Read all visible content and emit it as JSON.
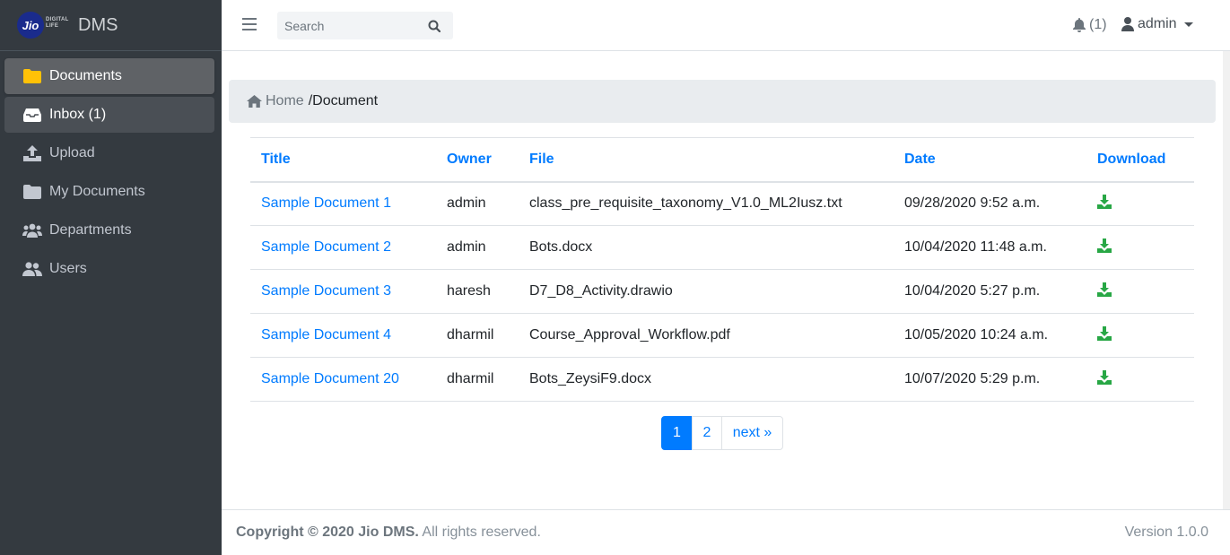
{
  "brand": {
    "logo_text": "Jio",
    "logo_tag_1": "DIGITAL",
    "logo_tag_2": "LIFE",
    "name": "DMS"
  },
  "sidebar": {
    "items": [
      {
        "label": "Documents",
        "icon": "folder-icon",
        "state": "active"
      },
      {
        "label": "Inbox (1)",
        "icon": "inbox-icon",
        "state": "open"
      },
      {
        "label": "Upload",
        "icon": "upload-icon",
        "state": ""
      },
      {
        "label": "My Documents",
        "icon": "folder-icon",
        "state": ""
      },
      {
        "label": "Departments",
        "icon": "users-group-icon",
        "state": ""
      },
      {
        "label": "Users",
        "icon": "users-icon",
        "state": ""
      }
    ]
  },
  "header": {
    "search_placeholder": "Search",
    "notification_count": "(1)",
    "user_name": "admin"
  },
  "breadcrumb": {
    "home": "Home",
    "current": "/Document"
  },
  "table": {
    "columns": [
      "Title",
      "Owner",
      "File",
      "Date",
      "Download"
    ],
    "rows": [
      {
        "title": "Sample Document 1",
        "owner": "admin",
        "file": "class_pre_requisite_taxonomy_V1.0_ML2Iusz.txt",
        "date": "09/28/2020 9:52 a.m."
      },
      {
        "title": "Sample Document 2",
        "owner": "admin",
        "file": "Bots.docx",
        "date": "10/04/2020 11:48 a.m."
      },
      {
        "title": "Sample Document 3",
        "owner": "haresh",
        "file": "D7_D8_Activity.drawio",
        "date": "10/04/2020 5:27 p.m."
      },
      {
        "title": "Sample Document 4",
        "owner": "dharmil",
        "file": "Course_Approval_Workflow.pdf",
        "date": "10/05/2020 10:24 a.m."
      },
      {
        "title": "Sample Document 20",
        "owner": "dharmil",
        "file": "Bots_ZeysiF9.docx",
        "date": "10/07/2020 5:29 p.m."
      }
    ]
  },
  "pagination": {
    "page1": "1",
    "page2": "2",
    "next": "next »"
  },
  "footer": {
    "copyright_bold": "Copyright © 2020 Jio DMS.",
    "copyright_rest": " All rights reserved.",
    "version": "Version 1.0.0"
  },
  "colors": {
    "sidebar_bg": "#343a40",
    "accent": "#007bff",
    "download": "#28a745",
    "folder": "#ffc107"
  }
}
